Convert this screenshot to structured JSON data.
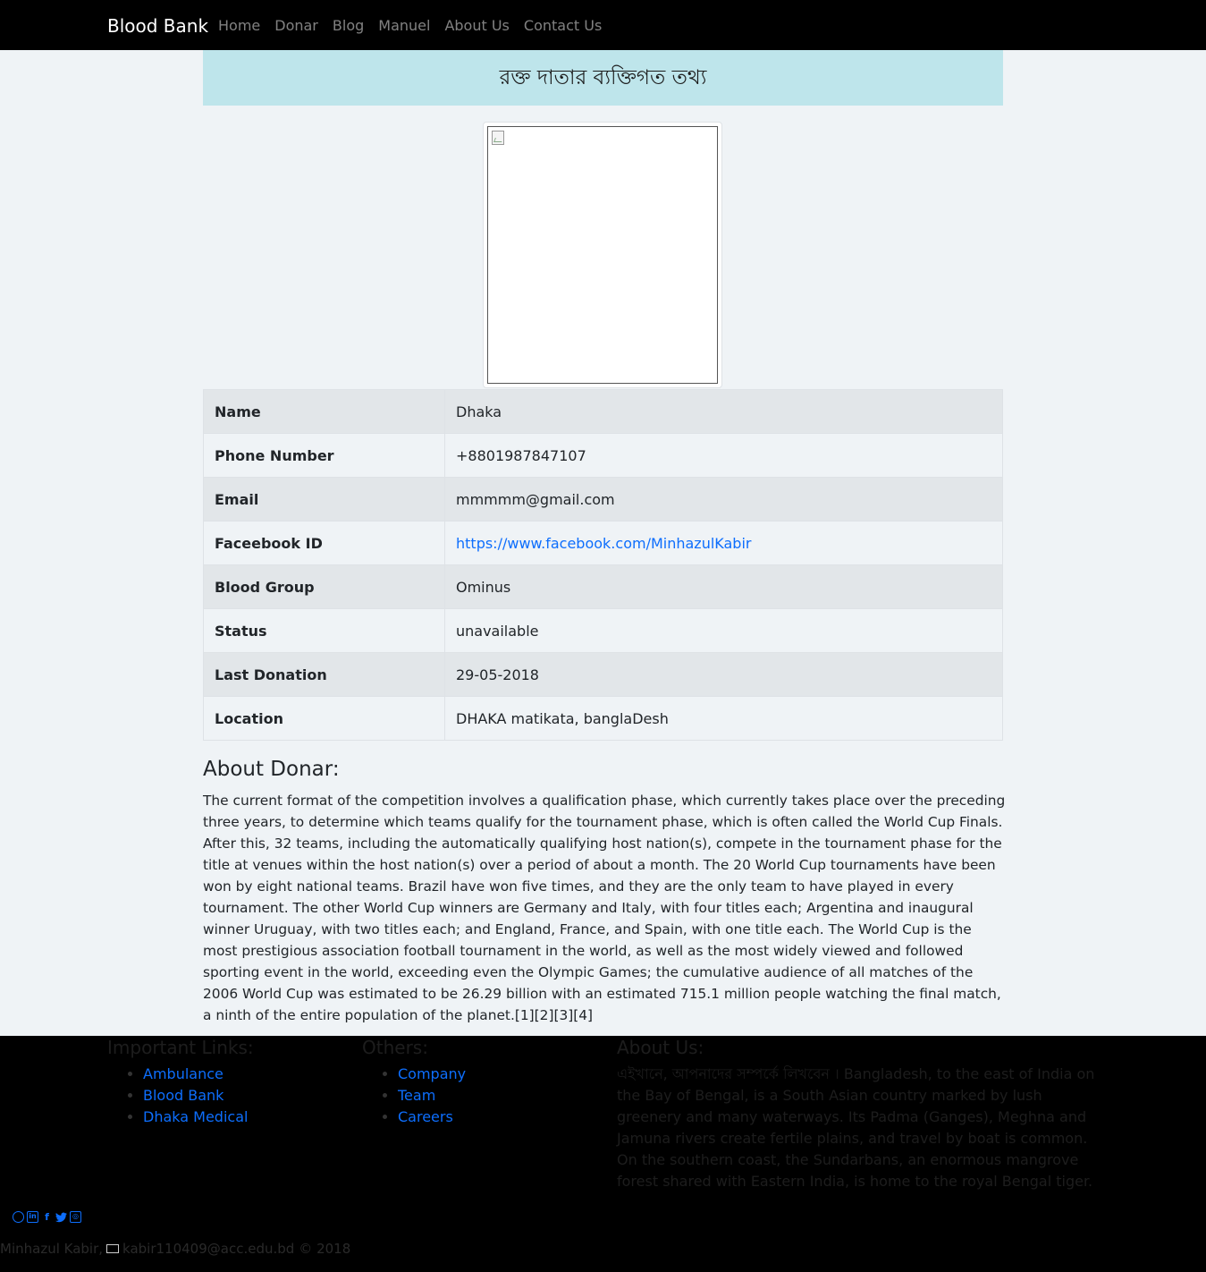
{
  "nav": {
    "brand": "Blood Bank",
    "links": [
      "Home",
      "Donar",
      "Blog",
      "Manuel",
      "About Us",
      "Contact Us"
    ]
  },
  "header": {
    "title": "রক্ত দাতার ব্যক্তিগত তথ্য"
  },
  "photo": {
    "icon": "broken-image-icon"
  },
  "donor": {
    "rows": [
      {
        "label": "Name",
        "value": "Dhaka"
      },
      {
        "label": "Phone Number",
        "value": "+8801987847107"
      },
      {
        "label": "Email",
        "value": "mmmmm@gmail.com"
      },
      {
        "label": "Faceebook ID",
        "value": "https://www.facebook.com/MinhazulKabir"
      },
      {
        "label": "Blood Group",
        "value": "Ominus"
      },
      {
        "label": "Status",
        "value": "unavailable"
      },
      {
        "label": "Last Donation",
        "value": "29-05-2018"
      },
      {
        "label": "Location",
        "value": "DHAKA matikata, banglaDesh"
      }
    ]
  },
  "about": {
    "heading": "About Donar:",
    "text": "The current format of the competition involves a qualification phase, which currently takes place over the preceding three years, to determine which teams qualify for the tournament phase, which is often called the World Cup Finals. After this, 32 teams, including the automatically qualifying host nation(s), compete in the tournament phase for the title at venues within the host nation(s) over a period of about a month. The 20 World Cup tournaments have been won by eight national teams. Brazil have won five times, and they are the only team to have played in every tournament. The other World Cup winners are Germany and Italy, with four titles each; Argentina and inaugural winner Uruguay, with two titles each; and England, France, and Spain, with one title each. The World Cup is the most prestigious association football tournament in the world, as well as the most widely viewed and followed sporting event in the world, exceeding even the Olympic Games; the cumulative audience of all matches of the 2006 World Cup was estimated to be 26.29 billion with an estimated 715.1 million people watching the final match, a ninth of the entire population of the planet.[1][2][3][4]"
  },
  "footer": {
    "important": {
      "heading": "Important Links:",
      "links": [
        "Ambulance",
        "Blood Bank",
        "Dhaka Medical"
      ]
    },
    "others": {
      "heading": "Others:",
      "links": [
        "Company",
        "Team",
        "Careers"
      ]
    },
    "aboutus": {
      "heading": "About Us:",
      "text": "এইখানে, আপনাদের সম্পর্কে লিখবেন । Bangladesh, to the east of India on the Bay of Bengal, is a South Asian country marked by lush greenery and many waterways. Its Padma (Ganges), Meghna and Jamuna rivers create fertile plains, and travel by boat is common. On the southern coast, the Sundarbans, an enormous mangrove forest shared with Eastern India, is home to the royal Bengal tiger."
    },
    "social_icons": [
      "github-icon",
      "linkedin-icon",
      "facebook-icon",
      "twitter-icon",
      "instagram-icon"
    ],
    "author": "Minhazul Kabir,",
    "email": "kabir110409@acc.edu.bd",
    "copyright": "© 2018"
  }
}
